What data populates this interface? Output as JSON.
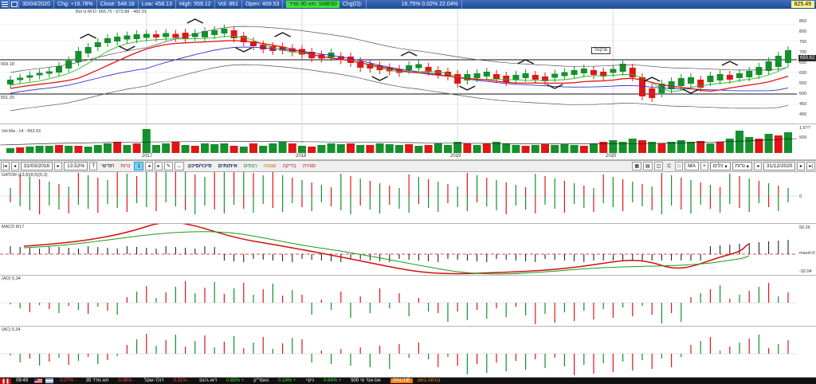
{
  "infobar": {
    "date": "30/04/2020",
    "chg": "Chg: +16.78%",
    "close": "Close: 548.18",
    "low": "Low: 458.13",
    "high": "High: 559.12",
    "vol": "Vol: 861",
    "open": "Open: 469.53",
    "green_tag": "תא 90 מדד: SME60",
    "chgo": "Chg(O):",
    "stats": "16.75% 0.02% 22.04%",
    "last_value": "825.49"
  },
  "price_panel": {
    "legend": "Bol U-M-D: 665.75 - 573.88 - 482.01",
    "left_labels": [
      "669.18",
      "501.29"
    ],
    "right_labels": [
      "850",
      "800",
      "750",
      "700",
      "650",
      "600",
      "550",
      "500",
      "450",
      "400"
    ],
    "current_tag": "693.62",
    "annotation": "פרקטל",
    "year_labels": [
      "2017",
      "2018",
      "2019",
      "2020"
    ],
    "colors": {
      "up": "#14902c",
      "down": "#e01616",
      "ma_red": "#e01616",
      "ma_green": "#22c022",
      "ma_blue": "#3030d0",
      "band": "#555555"
    }
  },
  "volume_panel": {
    "legend": "Vol Ma : 14 : 993.93",
    "right_labels": [
      "1,6??",
      "500"
    ]
  },
  "toolbar": {
    "start_date": "31/03/2016",
    "percent": "13.52%",
    "period_label": "חודשי",
    "type_label": "נרות",
    "page_num": "1",
    "link_signals": "סיכוי/סיכון",
    "link_alerts": "איתותים",
    "link_alert2": "רצפים",
    "link_trend": "שגמה",
    "link_check": "בדיקה",
    "link_scan": "סגירה",
    "ma_label": "MA",
    "select_all": "כלים",
    "select_type": "נרות",
    "end_date": "31/12/2020",
    "c_label": "C"
  },
  "gator_panel": {
    "legend": "GATOR (13,8)(8,5)(5,3)",
    "right_labels": [
      "0"
    ]
  },
  "macd_panel": {
    "legend": "MACD 8/17",
    "right_labels": [
      "50.26",
      "macd<0",
      "-32.04"
    ]
  },
  "ao_panel": {
    "legend": "(AO) 5,34"
  },
  "ac_panel": {
    "legend": "(AC) 5,34"
  },
  "ticker": {
    "time": "09:49",
    "items": [
      {
        "text": "0.07% -",
        "color": "red"
      },
      {
        "text": "35 תא מדד",
        "color": "white"
      },
      {
        "text": "0.06% -",
        "color": "red"
      },
      {
        "text": "דולר-שקל",
        "color": "white"
      },
      {
        "text": "0.31% -",
        "color": "red"
      },
      {
        "text": "דאו ג'ונס",
        "color": "white"
      },
      {
        "text": "0.65% +",
        "color": "green"
      },
      {
        "text": "נאסד\"ק",
        "color": "white"
      },
      {
        "text": "0.14% +",
        "color": "green"
      },
      {
        "text": "ניקיי",
        "color": "white"
      },
      {
        "text": "0.64% +",
        "color": "green"
      },
      {
        "text": "500 אס אנד פי",
        "color": "white"
      }
    ],
    "online": "ONLINE",
    "online_sub": "בורסה בזמן"
  }
}
